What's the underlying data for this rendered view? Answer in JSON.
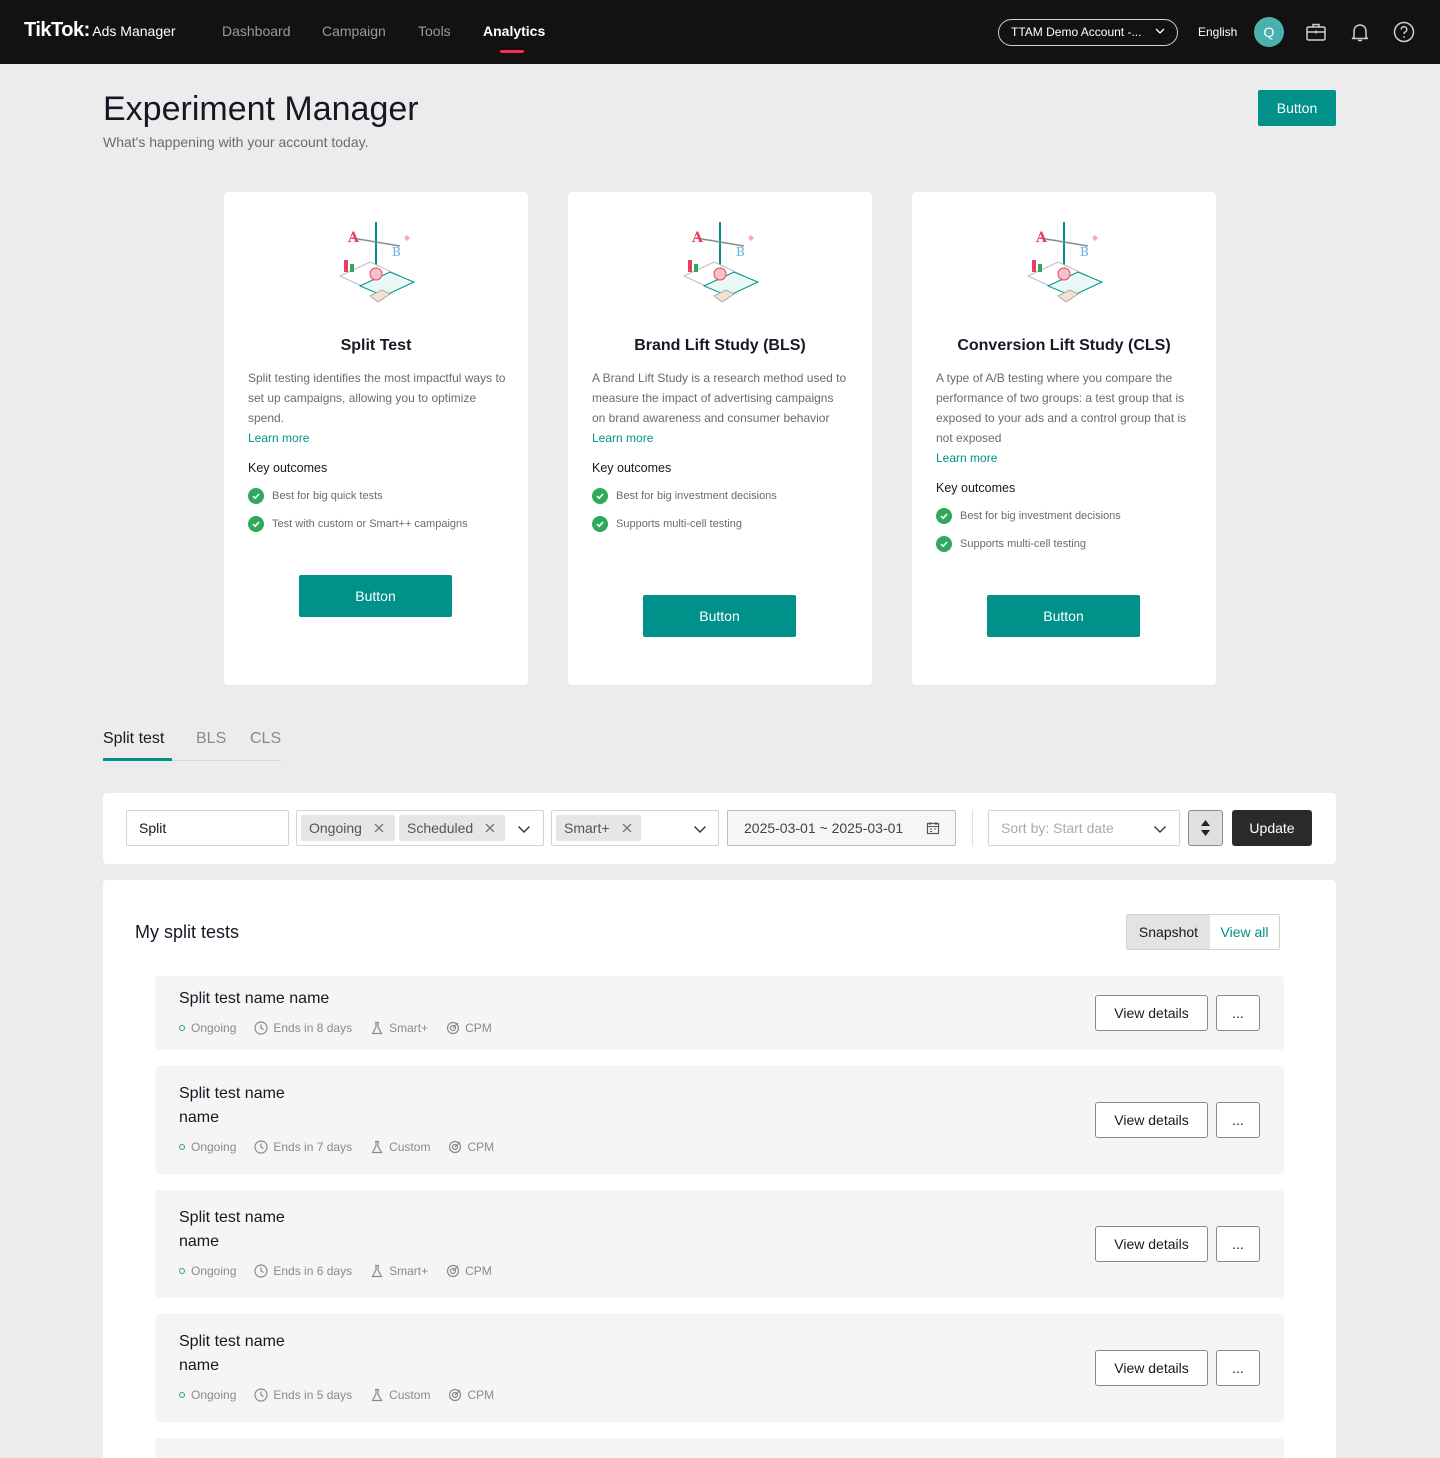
{
  "nav": {
    "logo": "TikTok",
    "logo_sub": "Ads Manager",
    "items": [
      "Dashboard",
      "Campaign",
      "Tools",
      "Analytics"
    ],
    "active": "Analytics",
    "account": "TTAM Demo Account -...",
    "language": "English",
    "avatar_initial": "Q"
  },
  "header": {
    "title": "Experiment Manager",
    "subtitle": "What's happening with your account today.",
    "button": "Button"
  },
  "cards": [
    {
      "title": "Split Test",
      "description": "Split testing identifies the most impactful ways to set up campaigns, allowing you to optimize spend.",
      "learn_more": "Learn more",
      "key_outcomes_label": "Key outcomes",
      "outcomes": [
        "Best for big quick tests",
        "Test with custom or Smart++ campaigns"
      ],
      "button": "Button"
    },
    {
      "title": "Brand Lift Study (BLS)",
      "description": "A Brand Lift Study is a research method used to measure the impact of advertising campaigns on brand awareness and consumer behavior",
      "learn_more": "Learn more",
      "key_outcomes_label": "Key outcomes",
      "outcomes": [
        "Best for big investment decisions",
        "Supports multi-cell testing"
      ],
      "button": "Button"
    },
    {
      "title": "Conversion Lift Study (CLS)",
      "description": "A type of A/B testing where you compare the performance of two groups: a test group that is exposed to your ads and a control group that is not exposed",
      "learn_more": "Learn more",
      "key_outcomes_label": "Key outcomes",
      "outcomes": [
        "Best for big investment decisions",
        "Supports multi-cell testing"
      ],
      "button": "Button"
    }
  ],
  "tabs": [
    "Split test",
    "BLS",
    "CLS"
  ],
  "filters": {
    "search_value": "Split",
    "status_chips": [
      "Ongoing",
      "Scheduled"
    ],
    "type_chips": [
      "Smart+"
    ],
    "date_range": "2025-03-01 ~ 2025-03-01",
    "sort_placeholder": "Sort by: Start date",
    "update": "Update"
  },
  "list": {
    "title": "My split tests",
    "toggle_snapshot": "Snapshot",
    "toggle_view_all": "View all",
    "view_details": "View details",
    "more": "...",
    "rows": [
      {
        "name": "Split test name name",
        "status": "Ongoing",
        "ends": "Ends in 8 days",
        "type": "Smart+",
        "metric": "CPM"
      },
      {
        "name": "Split test name name",
        "status": "Ongoing",
        "ends": "Ends in 7 days",
        "type": "Custom",
        "metric": "CPM"
      },
      {
        "name": "Split test name name",
        "status": "Ongoing",
        "ends": "Ends in 6 days",
        "type": "Smart+",
        "metric": "CPM"
      },
      {
        "name": "Split test name name",
        "status": "Ongoing",
        "ends": "Ends in 5 days",
        "type": "Custom",
        "metric": "CPM"
      }
    ]
  },
  "colors": {
    "accent": "#00918a",
    "nav_bg": "#121212",
    "nav_active_underline": "#fe2c55",
    "success": "#2fa95a"
  }
}
